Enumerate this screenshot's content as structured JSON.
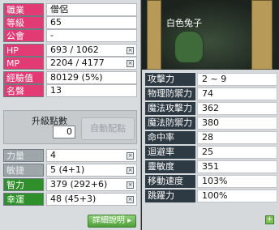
{
  "stats": [
    {
      "key": "job",
      "label": "職業",
      "value": "僧侶",
      "color": "pink"
    },
    {
      "key": "level",
      "label": "等級",
      "value": "65",
      "color": "pink"
    },
    {
      "key": "guild",
      "label": "公會",
      "value": "-",
      "color": "pink"
    },
    {
      "key": "hp",
      "label": "HP",
      "value": "693 / 1062",
      "color": "pink",
      "btn": true
    },
    {
      "key": "mp",
      "label": "MP",
      "value": "2204 / 4177",
      "color": "pink",
      "btn": true
    },
    {
      "key": "exp",
      "label": "經驗值",
      "value": "80129 (5%)",
      "color": "pink"
    },
    {
      "key": "fame",
      "label": "名聲",
      "value": "13",
      "color": "pink"
    }
  ],
  "ability_points": {
    "label": "升級點數",
    "value": "0",
    "auto_button": "自動配點"
  },
  "attributes": [
    {
      "key": "str",
      "label": "力量",
      "value": "4",
      "color": "grey"
    },
    {
      "key": "dex",
      "label": "敏捷",
      "value": "5 (4+1)",
      "color": "grey"
    },
    {
      "key": "int",
      "label": "智力",
      "value": "379 (292+6)",
      "color": "green"
    },
    {
      "key": "luk",
      "label": "幸運",
      "value": "48 (45+3)",
      "color": "green"
    }
  ],
  "detail_button": "詳細說明",
  "scene": {
    "mob_name": "白色兔子"
  },
  "details": [
    {
      "label": "攻擊力",
      "value": "2 ~ 9"
    },
    {
      "label": "物理防禦力",
      "value": "74"
    },
    {
      "label": "魔法攻擊力",
      "value": "362"
    },
    {
      "label": "魔法防禦力",
      "value": "380"
    },
    {
      "label": "命中率",
      "value": "28"
    },
    {
      "label": "迴避率",
      "value": "25"
    },
    {
      "label": "靈敏度",
      "value": "351"
    },
    {
      "label": "移動速度",
      "value": "103%"
    },
    {
      "label": "跳躍力",
      "value": "100%"
    }
  ],
  "plus_button": "+",
  "colors": {
    "pink": "#e23a73",
    "green": "#2f8f2a",
    "grey": "#9ea6aa",
    "dark_label": "#2e3a43"
  }
}
